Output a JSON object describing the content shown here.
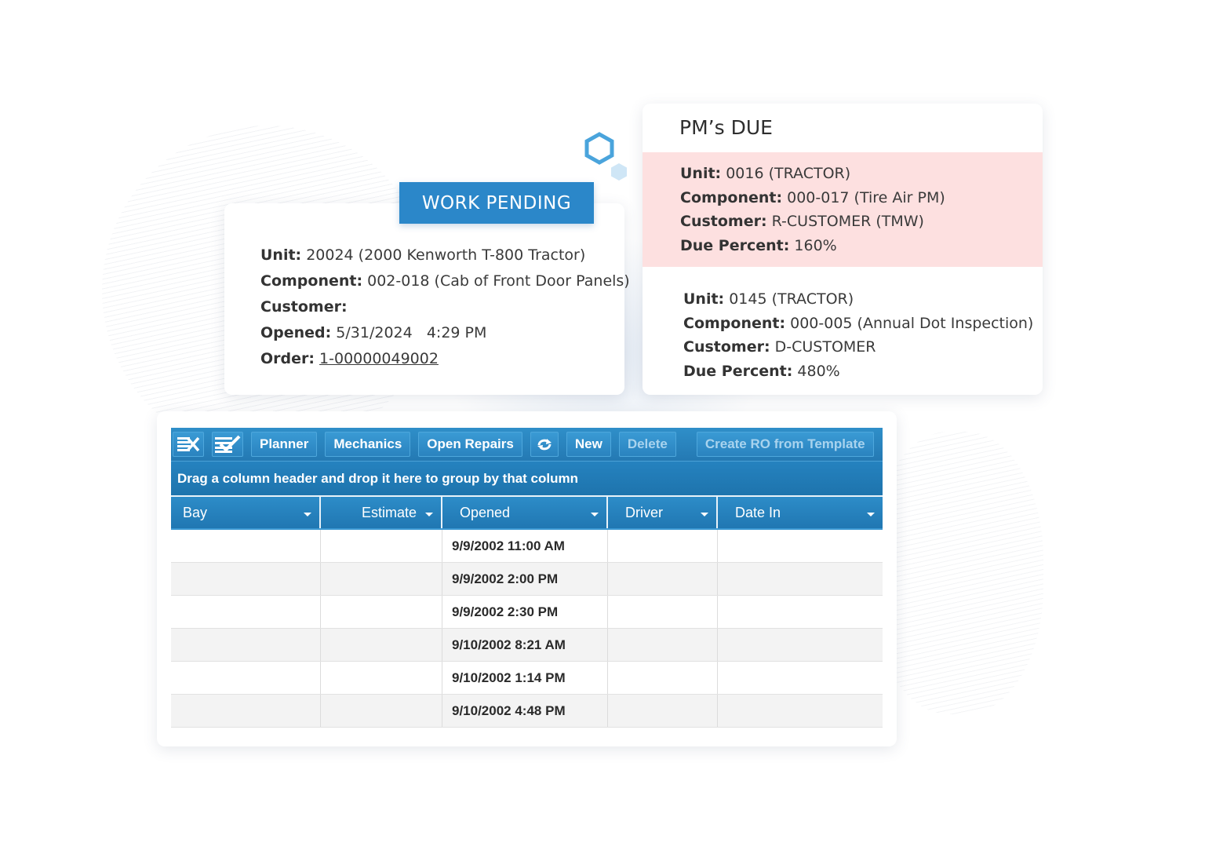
{
  "work_pending": {
    "badge": "WORK PENDING",
    "fields": [
      {
        "label": "Unit:",
        "value": "20024 (2000 Kenworth T-800 Tractor)"
      },
      {
        "label": "Component:",
        "value": "002-018 (Cab of Front Door Panels)"
      },
      {
        "label": "Customer:",
        "value": ""
      },
      {
        "label": "Opened:",
        "value": "5/31/2024   4:29 PM"
      }
    ],
    "order_label": "Order:",
    "order_link": "1-00000049002"
  },
  "pms_due": {
    "title": "PM’s DUE",
    "items": [
      {
        "unit_label": "Unit:",
        "unit": "0016 (TRACTOR)",
        "component_label": "Component:",
        "component": "000-017 (Tire Air PM)",
        "customer_label": "Customer:",
        "customer": "R-CUSTOMER (TMW)",
        "due_label": "Due Percent:",
        "due": "160%"
      },
      {
        "unit_label": "Unit:",
        "unit": "0145 (TRACTOR)",
        "component_label": "Component:",
        "component": "000-005 (Annual Dot Inspection)",
        "customer_label": "Customer:",
        "customer": "D-CUSTOMER",
        "due_label": "Due Percent:",
        "due": "480%"
      }
    ],
    "highlight_color": "#fde0e0"
  },
  "grid": {
    "toolbar": {
      "planner": "Planner",
      "mechanics": "Mechanics",
      "open_repairs": "Open Repairs",
      "new": "New",
      "delete": "Delete",
      "create_ro": "Create RO from Template"
    },
    "group_hint": "Drag a column header and drop it here to group by that column",
    "columns": [
      "Bay",
      "Estimate",
      "Opened",
      "Driver",
      "Date In"
    ],
    "rows": [
      {
        "bay": "",
        "estimate": "",
        "opened": "9/9/2002 11:00 AM",
        "driver": "",
        "date_in": ""
      },
      {
        "bay": "",
        "estimate": "",
        "opened": "9/9/2002 2:00 PM",
        "driver": "",
        "date_in": ""
      },
      {
        "bay": "",
        "estimate": "",
        "opened": "9/9/2002 2:30 PM",
        "driver": "",
        "date_in": ""
      },
      {
        "bay": "",
        "estimate": "",
        "opened": "9/10/2002 8:21 AM",
        "driver": "",
        "date_in": ""
      },
      {
        "bay": "",
        "estimate": "",
        "opened": "9/10/2002 1:14 PM",
        "driver": "",
        "date_in": ""
      },
      {
        "bay": "",
        "estimate": "",
        "opened": "9/10/2002 4:48 PM",
        "driver": "",
        "date_in": ""
      }
    ],
    "accent": "#2b87c9"
  }
}
